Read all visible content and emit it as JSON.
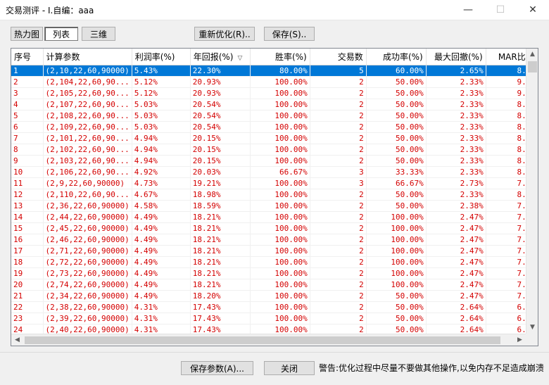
{
  "window": {
    "title": "交易测评 - I.自编：aaa"
  },
  "toolbar": {
    "heatmap": "热力图",
    "list": "列表",
    "threed": "三维",
    "reoptimize": "重新优化(R)..",
    "save": "保存(S).."
  },
  "table": {
    "columns": [
      "序号",
      "计算参数",
      "利润率(%)",
      "年回报(%)",
      "胜率(%)",
      "交易数",
      "成功率(%)",
      "最大回撤(%)",
      "MAR比"
    ],
    "sorted_column": "年回报(%)",
    "selected_row": 1,
    "rows": [
      [
        "1",
        "(2,10,22,60,90000)",
        "5.43%",
        "22.30%",
        "80.00%",
        "5",
        "60.00%",
        "2.65%",
        "8."
      ],
      [
        "2",
        "(2,104,22,60,90...",
        "5.12%",
        "20.93%",
        "100.00%",
        "2",
        "50.00%",
        "2.33%",
        "9."
      ],
      [
        "3",
        "(2,105,22,60,90...",
        "5.12%",
        "20.93%",
        "100.00%",
        "2",
        "50.00%",
        "2.33%",
        "9."
      ],
      [
        "4",
        "(2,107,22,60,90...",
        "5.03%",
        "20.54%",
        "100.00%",
        "2",
        "50.00%",
        "2.33%",
        "8."
      ],
      [
        "5",
        "(2,108,22,60,90...",
        "5.03%",
        "20.54%",
        "100.00%",
        "2",
        "50.00%",
        "2.33%",
        "8."
      ],
      [
        "6",
        "(2,109,22,60,90...",
        "5.03%",
        "20.54%",
        "100.00%",
        "2",
        "50.00%",
        "2.33%",
        "8."
      ],
      [
        "7",
        "(2,101,22,60,90...",
        "4.94%",
        "20.15%",
        "100.00%",
        "2",
        "50.00%",
        "2.33%",
        "8."
      ],
      [
        "8",
        "(2,102,22,60,90...",
        "4.94%",
        "20.15%",
        "100.00%",
        "2",
        "50.00%",
        "2.33%",
        "8."
      ],
      [
        "9",
        "(2,103,22,60,90...",
        "4.94%",
        "20.15%",
        "100.00%",
        "2",
        "50.00%",
        "2.33%",
        "8."
      ],
      [
        "10",
        "(2,106,22,60,90...",
        "4.92%",
        "20.03%",
        "66.67%",
        "3",
        "33.33%",
        "2.33%",
        "8."
      ],
      [
        "11",
        "(2,9,22,60,90000)",
        "4.73%",
        "19.21%",
        "100.00%",
        "3",
        "66.67%",
        "2.73%",
        "7."
      ],
      [
        "12",
        "(2,110,22,60,90...",
        "4.67%",
        "18.98%",
        "100.00%",
        "2",
        "50.00%",
        "2.33%",
        "8."
      ],
      [
        "13",
        "(2,36,22,60,90000)",
        "4.58%",
        "18.59%",
        "100.00%",
        "2",
        "50.00%",
        "2.38%",
        "7."
      ],
      [
        "14",
        "(2,44,22,60,90000)",
        "4.49%",
        "18.21%",
        "100.00%",
        "2",
        "100.00%",
        "2.47%",
        "7."
      ],
      [
        "15",
        "(2,45,22,60,90000)",
        "4.49%",
        "18.21%",
        "100.00%",
        "2",
        "100.00%",
        "2.47%",
        "7."
      ],
      [
        "16",
        "(2,46,22,60,90000)",
        "4.49%",
        "18.21%",
        "100.00%",
        "2",
        "100.00%",
        "2.47%",
        "7."
      ],
      [
        "17",
        "(2,71,22,60,90000)",
        "4.49%",
        "18.21%",
        "100.00%",
        "2",
        "100.00%",
        "2.47%",
        "7."
      ],
      [
        "18",
        "(2,72,22,60,90000)",
        "4.49%",
        "18.21%",
        "100.00%",
        "2",
        "100.00%",
        "2.47%",
        "7."
      ],
      [
        "19",
        "(2,73,22,60,90000)",
        "4.49%",
        "18.21%",
        "100.00%",
        "2",
        "100.00%",
        "2.47%",
        "7."
      ],
      [
        "20",
        "(2,74,22,60,90000)",
        "4.49%",
        "18.21%",
        "100.00%",
        "2",
        "100.00%",
        "2.47%",
        "7."
      ],
      [
        "21",
        "(2,34,22,60,90000)",
        "4.49%",
        "18.20%",
        "100.00%",
        "2",
        "50.00%",
        "2.47%",
        "7."
      ],
      [
        "22",
        "(2,38,22,60,90000)",
        "4.31%",
        "17.43%",
        "100.00%",
        "2",
        "50.00%",
        "2.64%",
        "6."
      ],
      [
        "23",
        "(2,39,22,60,90000)",
        "4.31%",
        "17.43%",
        "100.00%",
        "2",
        "50.00%",
        "2.64%",
        "6."
      ],
      [
        "24",
        "(2,40,22,60,90000)",
        "4.31%",
        "17.43%",
        "100.00%",
        "2",
        "50.00%",
        "2.64%",
        "6."
      ]
    ]
  },
  "footer": {
    "save_params": "保存参数(A)...",
    "close": "关闭",
    "warning": "警告:优化过程中尽量不要做其他操作,以免内存不足造成崩溃"
  },
  "icons": {
    "minimize": "minimize-icon",
    "maximize": "maximize-icon",
    "close": "close-icon",
    "sort": "sort-desc-icon"
  }
}
